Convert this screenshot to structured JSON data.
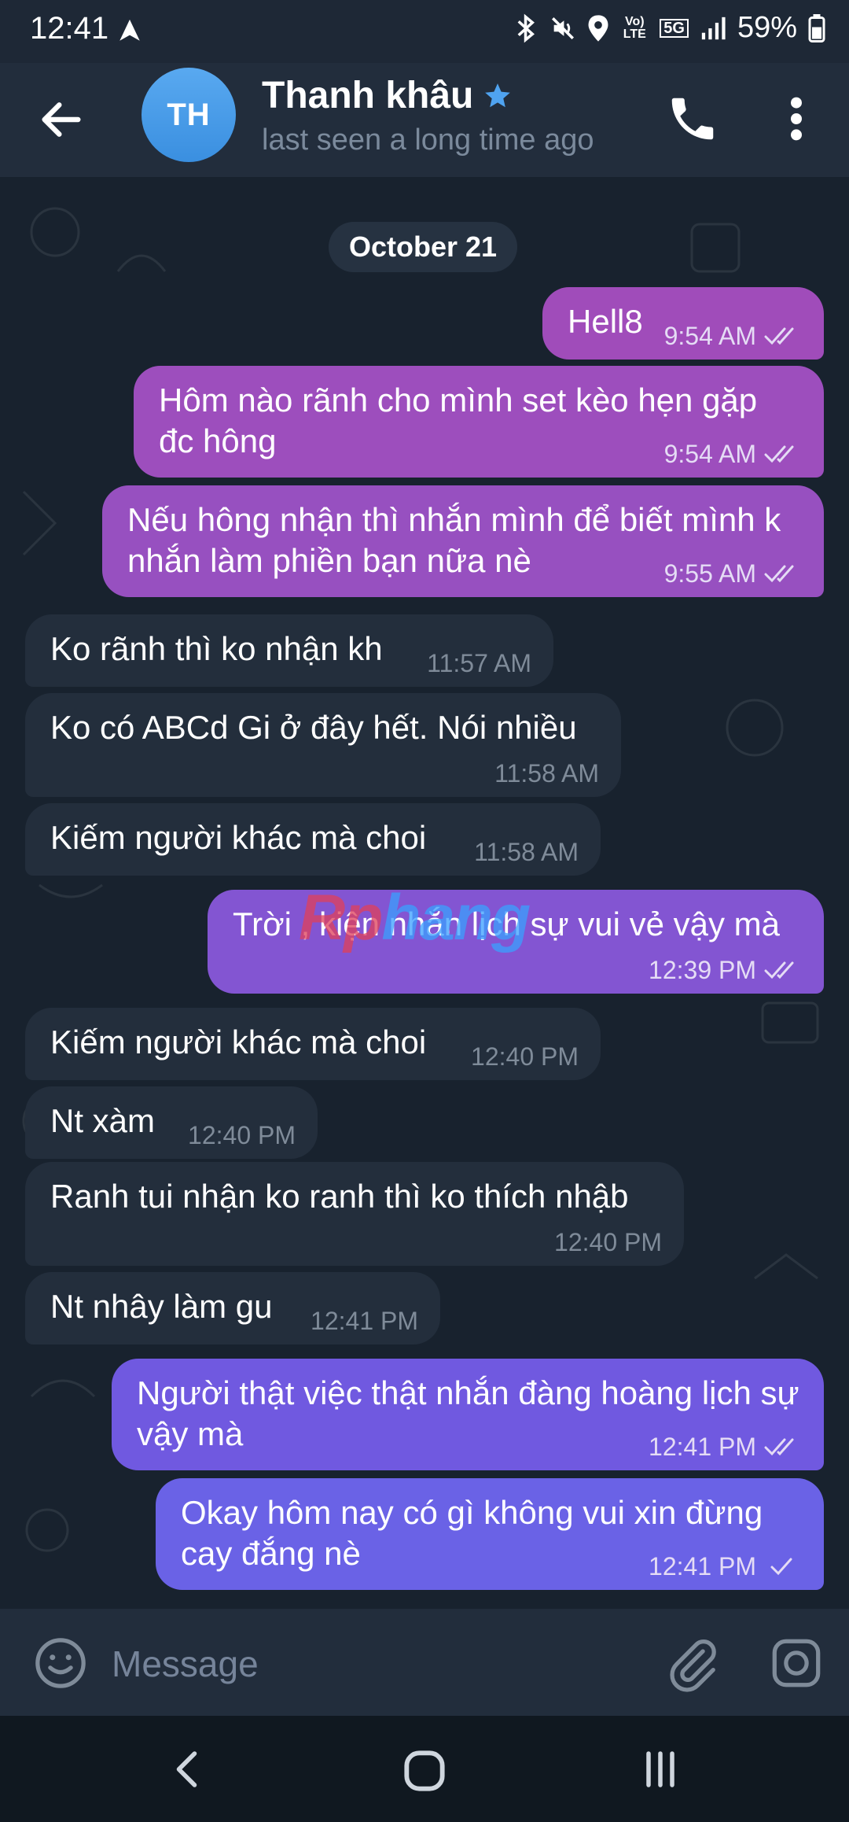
{
  "status_bar": {
    "time": "12:41",
    "battery": "59%",
    "network_label": "5G",
    "volte_label": "Vo) LTE"
  },
  "header": {
    "avatar_initials": "TH",
    "contact_name": "Thanh khâu",
    "status": "last seen a long time ago"
  },
  "chat": {
    "date_label": "October 21",
    "messages": [
      {
        "dir": "out",
        "text": "Hell8",
        "time": "9:54 AM",
        "ticks": "double"
      },
      {
        "dir": "out",
        "text": "Hôm nào rãnh cho mình set kèo hẹn gặp đc hông",
        "time": "9:54 AM",
        "ticks": "double"
      },
      {
        "dir": "out",
        "text": "Nếu hông nhận thì nhắn mình để biết mình k nhắn làm phiền bạn nữa nè",
        "time": "9:55 AM",
        "ticks": "double"
      },
      {
        "dir": "in",
        "text": "Ko rãnh thì ko nhận kh",
        "time": "11:57 AM"
      },
      {
        "dir": "in",
        "text": "Ko có ABCd Gi ở đây hết. Nói nhiều",
        "time": "11:58 AM"
      },
      {
        "dir": "in",
        "text": "Kiếm người khác mà choi",
        "time": "11:58 AM"
      },
      {
        "dir": "out",
        "text": "Trời , kiện nhắn lịch sự vui vẻ vậy mà",
        "time": "12:39 PM",
        "ticks": "double"
      },
      {
        "dir": "in",
        "text": "Kiếm người khác mà choi",
        "time": "12:40 PM"
      },
      {
        "dir": "in",
        "text": "Nt xàm",
        "time": "12:40 PM"
      },
      {
        "dir": "in",
        "text": "Ranh tui nhận ko ranh thì ko thích nhậb",
        "time": "12:40 PM"
      },
      {
        "dir": "in",
        "text": "Nt nhây làm gu",
        "time": "12:41 PM"
      },
      {
        "dir": "out",
        "text": "Người thật việc thật nhắn đàng hoàng lịch sự vậy mà",
        "time": "12:41 PM",
        "ticks": "double"
      },
      {
        "dir": "out",
        "text": "Okay hôm nay có gì không vui xin đừng cay đắng nè",
        "time": "12:41 PM",
        "ticks": "single"
      }
    ],
    "watermark_red": "Rp",
    "watermark_blue": "hang"
  },
  "input": {
    "placeholder": "Message"
  },
  "colors": {
    "chat_bg": "#18222e",
    "incoming_bubble": "#232e3c",
    "outgoing_top": "#9a4fbf",
    "outgoing_bottom": "#6a62e6",
    "accent_star": "#4fa3f0"
  }
}
